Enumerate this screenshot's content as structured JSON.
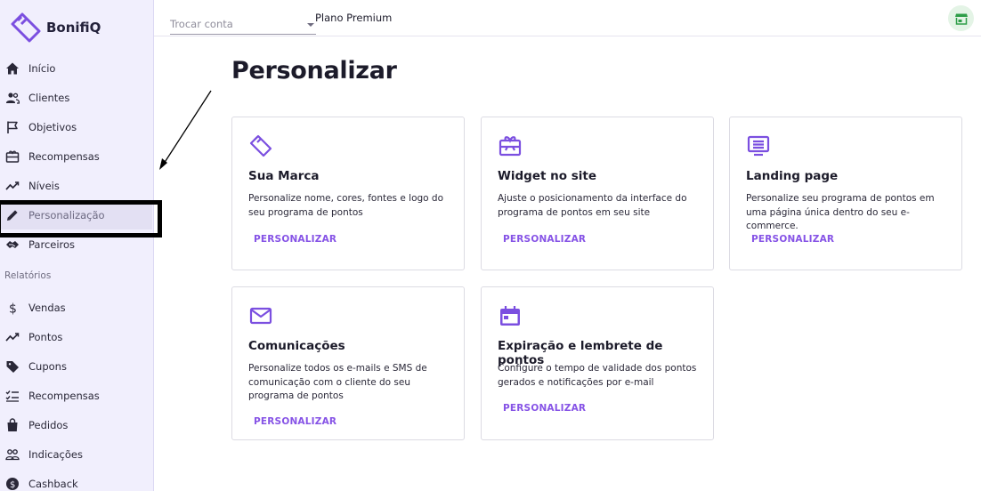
{
  "brand": {
    "name": "BonifiQ"
  },
  "sidebar": {
    "items": [
      {
        "label": "Início",
        "icon": "home-icon"
      },
      {
        "label": "Clientes",
        "icon": "users-icon"
      },
      {
        "label": "Objetivos",
        "icon": "flag-icon"
      },
      {
        "label": "Recompensas",
        "icon": "gift-card-icon"
      },
      {
        "label": "Níveis",
        "icon": "trend-icon"
      },
      {
        "label": "Personalização",
        "icon": "pencil-icon"
      },
      {
        "label": "Parceiros",
        "icon": "handshake-icon"
      }
    ],
    "reports_label": "Relatórios",
    "report_items": [
      {
        "label": "Vendas",
        "icon": "dollar-icon"
      },
      {
        "label": "Pontos",
        "icon": "trend-icon"
      },
      {
        "label": "Cupons",
        "icon": "tag-icon"
      },
      {
        "label": "Recompensas",
        "icon": "checklist-icon"
      },
      {
        "label": "Pedidos",
        "icon": "bag-icon"
      },
      {
        "label": "Indicações",
        "icon": "people-icon"
      },
      {
        "label": "Cashback",
        "icon": "coin-icon"
      }
    ]
  },
  "topbar": {
    "account_placeholder": "Trocar conta",
    "plan": "Plano Premium"
  },
  "main": {
    "title": "Personalizar",
    "cards": [
      {
        "title": "Sua Marca",
        "desc": "Personalize nome, cores, fontes e logo do seu programa de pontos",
        "link": "PERSONALIZAR"
      },
      {
        "title": "Widget no site",
        "desc": "Ajuste o posicionamento da interface do programa de pontos em seu site",
        "link": "PERSONALIZAR"
      },
      {
        "title": "Landing page",
        "desc": "Personalize seu programa de pontos em uma página única dentro do seu e-commerce.",
        "link": "PERSONALIZAR"
      },
      {
        "title": "Comunicações",
        "desc": "Personalize todos os e-mails e SMS de comunicação com o cliente do seu programa de pontos",
        "link": "PERSONALIZAR"
      },
      {
        "title": "Expiração e lembrete de pontos",
        "desc": "Configure o tempo de validade dos pontos gerados e notificações por e-mail",
        "link": "PERSONALIZAR"
      }
    ]
  },
  "colors": {
    "accent": "#7b4fe0",
    "sidebar_bg": "#f1effd",
    "store_btn_bg": "#e4f4e6",
    "store_icon": "#2e9e48"
  }
}
